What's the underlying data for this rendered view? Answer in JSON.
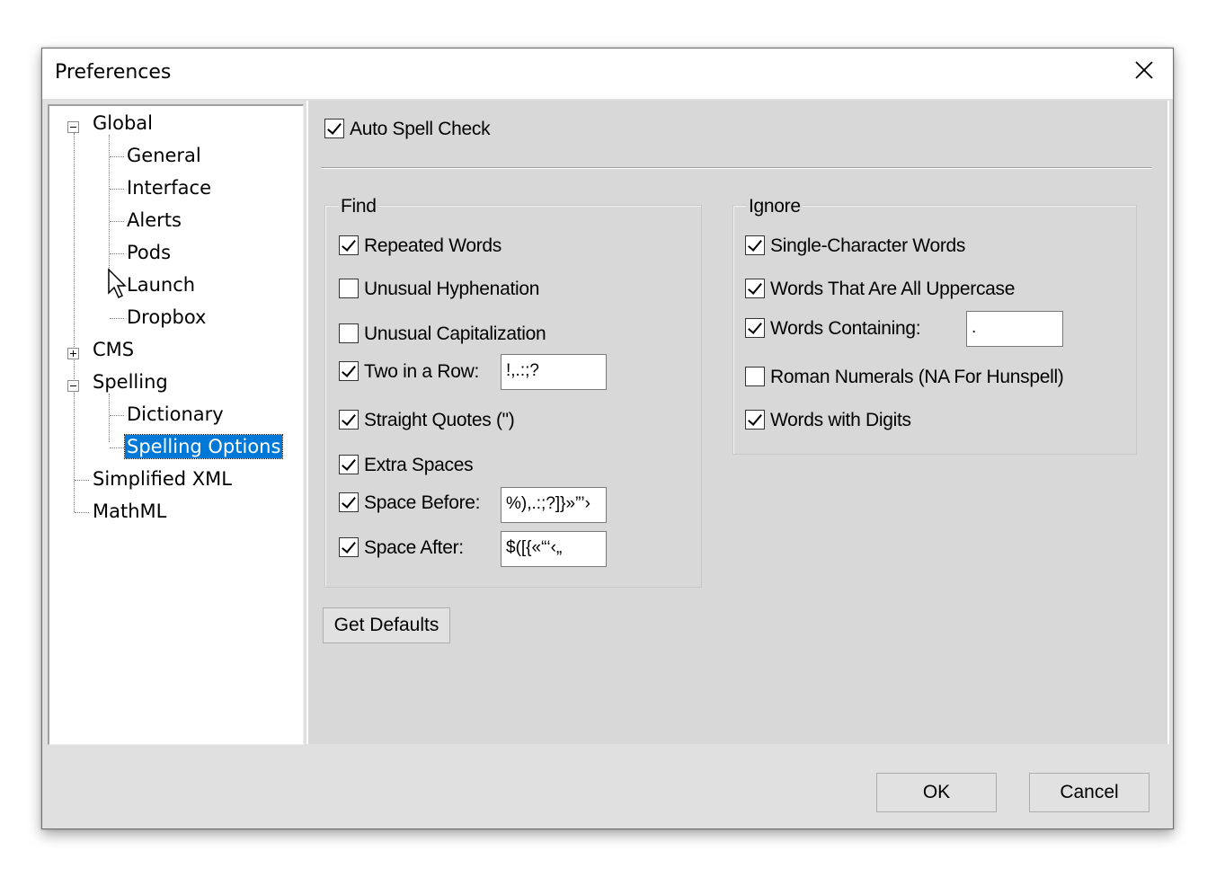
{
  "window": {
    "title": "Preferences"
  },
  "tree": {
    "global": "Global",
    "general": "General",
    "interface": "Interface",
    "alerts": "Alerts",
    "pods": "Pods",
    "launch": "Launch",
    "dropbox": "Dropbox",
    "cms": "CMS",
    "spelling": "Spelling",
    "dictionary": "Dictionary",
    "spelling_options": "Spelling Options",
    "simplified_xml": "Simplified XML",
    "mathml": "MathML"
  },
  "auto_spell": {
    "label": "Auto Spell Check",
    "checked": true
  },
  "find": {
    "title": "Find",
    "repeated_words": {
      "label": "Repeated Words",
      "checked": true
    },
    "unusual_hyphenation": {
      "label": "Unusual Hyphenation",
      "checked": false
    },
    "unusual_capitalization": {
      "label": "Unusual Capitalization",
      "checked": false
    },
    "two_in_row": {
      "label": "Two in a Row:",
      "checked": true,
      "value": "!,.:;?"
    },
    "straight_quotes": {
      "label": "Straight Quotes (\")",
      "checked": true
    },
    "extra_spaces": {
      "label": "Extra Spaces",
      "checked": true
    },
    "space_before": {
      "label": "Space Before:",
      "checked": true,
      "value": "%),.:;?]}»”’›"
    },
    "space_after": {
      "label": "Space After:",
      "checked": true,
      "value": "$([{«“‘‹„"
    }
  },
  "ignore": {
    "title": "Ignore",
    "single_char": {
      "label": "Single-Character Words",
      "checked": true
    },
    "all_uppercase": {
      "label": "Words That Are All Uppercase",
      "checked": true
    },
    "containing": {
      "label": "Words Containing:",
      "checked": true,
      "value": "."
    },
    "roman_numerals": {
      "label": "Roman Numerals (NA For Hunspell)",
      "checked": false
    },
    "with_digits": {
      "label": "Words with Digits",
      "checked": true
    }
  },
  "buttons": {
    "get_defaults": "Get Defaults",
    "ok": "OK",
    "cancel": "Cancel"
  }
}
